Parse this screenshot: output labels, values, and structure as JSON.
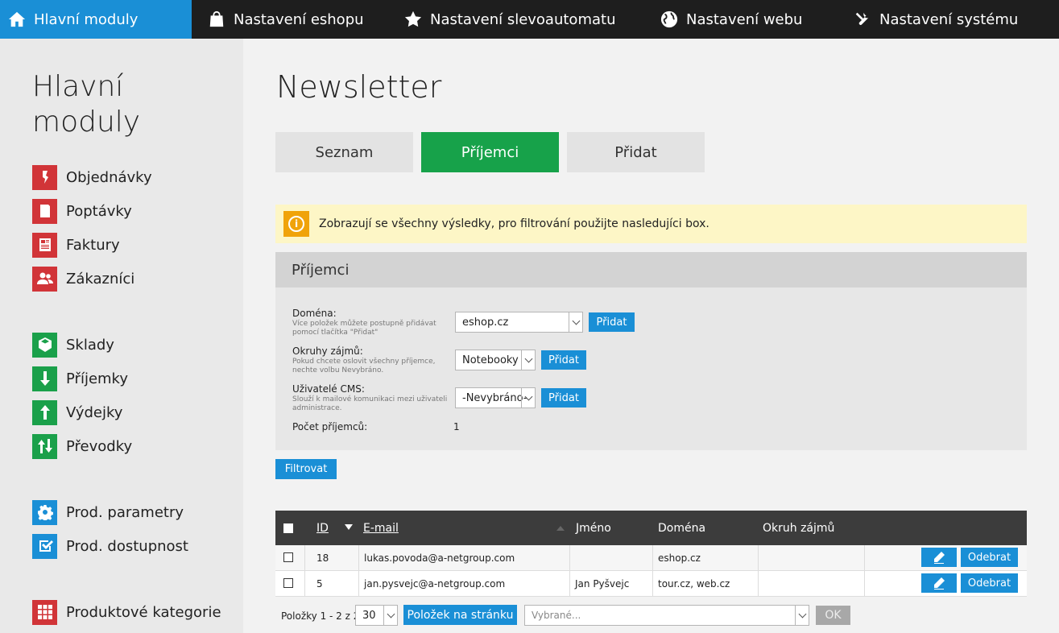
{
  "topnav": [
    {
      "label": "Hlavní moduly",
      "icon": "home-icon",
      "active": true
    },
    {
      "label": "Nastavení eshopu",
      "icon": "shopping-bag-icon"
    },
    {
      "label": "Nastavení slevoautomatu",
      "icon": "star-icon"
    },
    {
      "label": "Nastavení webu",
      "icon": "globe-icon"
    },
    {
      "label": "Nastavení systému",
      "icon": "tools-icon"
    }
  ],
  "sidebar": {
    "title": "Hlavní moduly",
    "items": [
      {
        "label": "Objednávky",
        "icon": "orders-icon",
        "color": "#d13438"
      },
      {
        "label": "Poptávky",
        "icon": "inquiries-icon",
        "color": "#d13438"
      },
      {
        "label": "Faktury",
        "icon": "invoices-icon",
        "color": "#d13438"
      },
      {
        "label": "Zákazníci",
        "icon": "customers-icon",
        "color": "#d13438"
      },
      {
        "label": "Sklady",
        "icon": "warehouse-icon",
        "color": "#1aa04a"
      },
      {
        "label": "Příjemky",
        "icon": "arrow-down-icon",
        "color": "#1aa04a"
      },
      {
        "label": "Výdejky",
        "icon": "arrow-up-icon",
        "color": "#1aa04a"
      },
      {
        "label": "Převodky",
        "icon": "transfer-icon",
        "color": "#1aa04a"
      },
      {
        "label": "Prod. parametry",
        "icon": "gear-icon",
        "color": "#1a8fd6"
      },
      {
        "label": "Prod. dostupnost",
        "icon": "checkmark-icon",
        "color": "#1a8fd6"
      },
      {
        "label": "Produktové kategorie",
        "icon": "grid-icon",
        "color": "#d13438"
      }
    ]
  },
  "page": {
    "title": "Newsletter",
    "tabs": [
      "Seznam",
      "Příjemci",
      "Přidat"
    ],
    "active_tab": "Příjemci"
  },
  "alert": {
    "icon": "info-icon",
    "text": "Zobrazují se všechny výsledky, pro filtrování použijte nasledujíci box."
  },
  "filter": {
    "title": "Příjemci",
    "domain": {
      "label": "Doména:",
      "hint": "Více položek můžete postupně přidávat pomocí tlačítka \"Přidat\"",
      "value": "eshop.cz",
      "button": "Přidat"
    },
    "interests": {
      "label": "Okruhy zájmů:",
      "hint": "Pokud chcete oslovit všechny příjemce, nechte volbu Nevybráno.",
      "value": "Notebooky",
      "button": "Přidat"
    },
    "cms_users": {
      "label": "Uživatelé CMS:",
      "hint": "Slouží k mailové komunikaci mezi uživateli administrace.",
      "value": "-Nevybráno-",
      "button": "Přidat"
    },
    "count_label": "Počet příjemců:",
    "count_value": "1",
    "submit": "Filtrovat"
  },
  "table": {
    "columns": [
      "ID",
      "E-mail",
      "Jméno",
      "Doména",
      "Okruh zájmů"
    ],
    "rows": [
      {
        "id": "18",
        "email": "lukas.povoda@a-netgroup.com",
        "name": "",
        "domain": "eshop.cz",
        "interest": "",
        "remove": "Odebrat"
      },
      {
        "id": "5",
        "email": "jan.pysvejc@a-netgroup.com",
        "name": "Jan Pyšvejc",
        "domain": "tour.cz, web.cz",
        "interest": "",
        "remove": "Odebrat"
      }
    ]
  },
  "pager": {
    "label": "Položky 1 - 2 z 2",
    "per_page": "30",
    "per_page_button": "Položek na stránku",
    "bulk_placeholder": "Vybrané...",
    "ok": "OK"
  }
}
